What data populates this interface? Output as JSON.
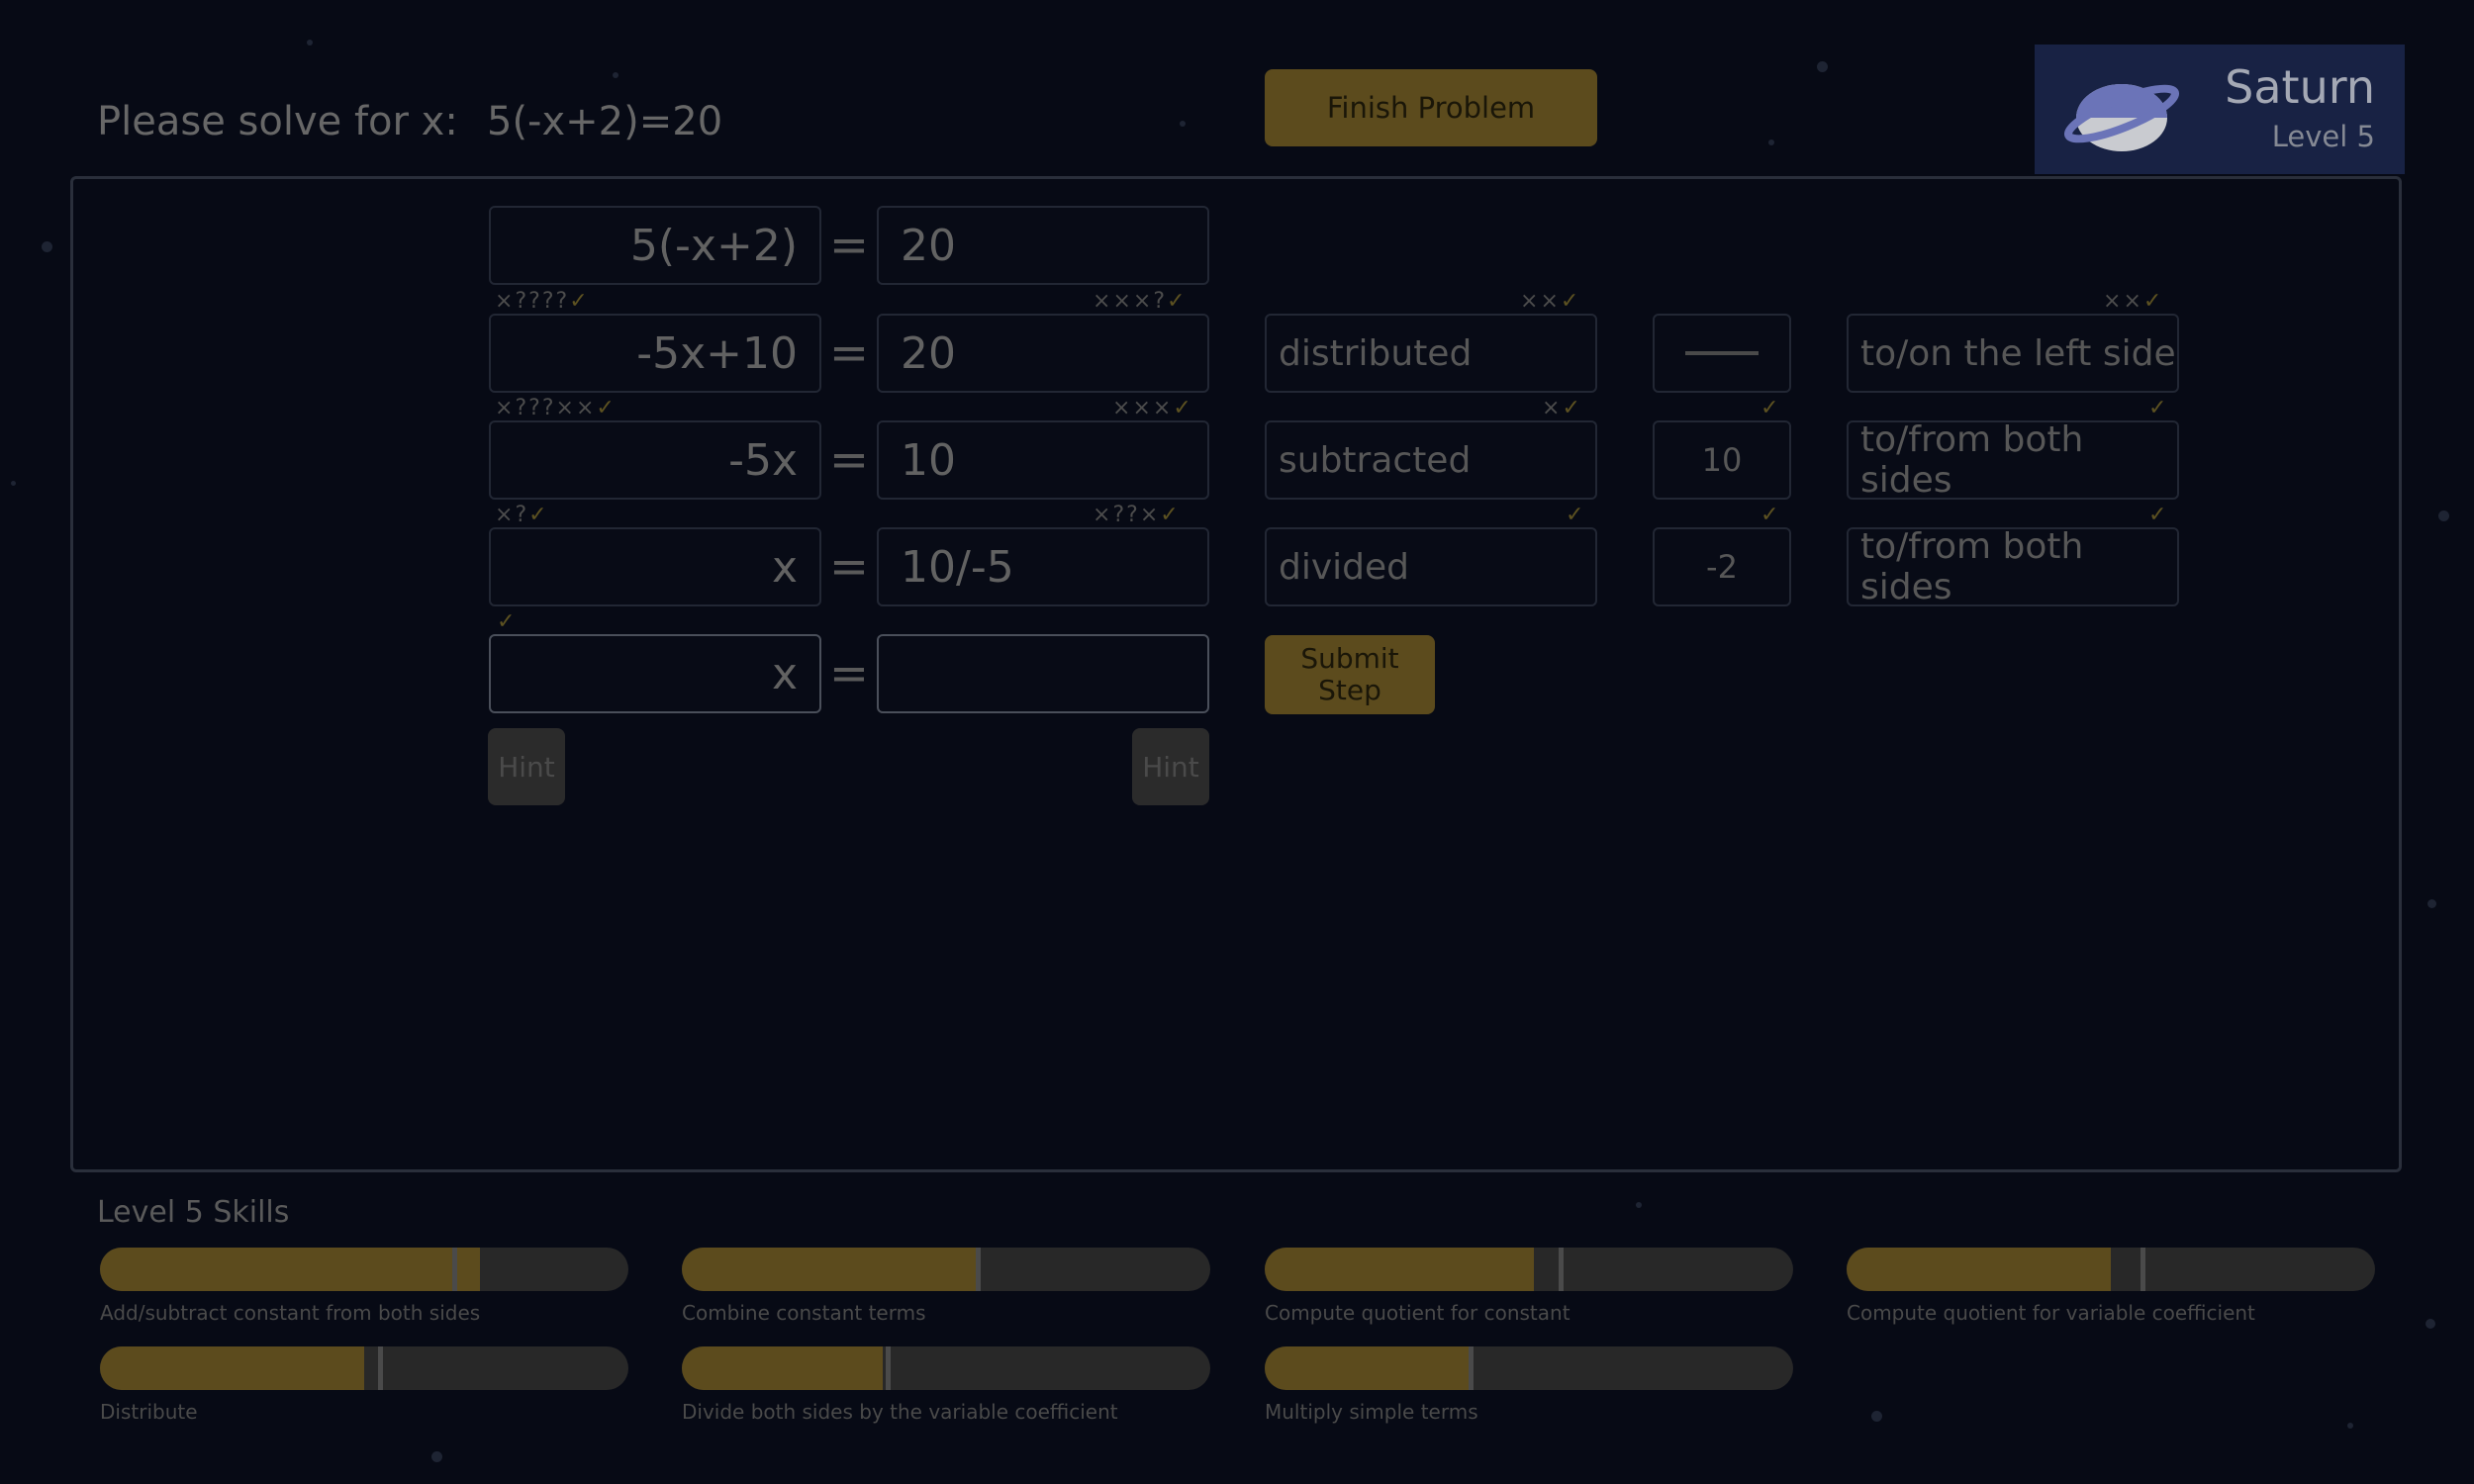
{
  "prompt": {
    "label": "Please solve for x:",
    "equation": "5(-x+2)=20"
  },
  "finish_button": "Finish Problem",
  "planet": {
    "name": "Saturn",
    "level": "Level 5"
  },
  "rows": [
    {
      "left": "5(-x+2)",
      "right": "20",
      "equals": "="
    },
    {
      "left": "-5x+10",
      "right": "20",
      "equals": "=",
      "action": "distributed",
      "value": "",
      "where": "to/on the left side",
      "marks_left": [
        "×",
        "?",
        "?",
        "?",
        "?",
        "✓"
      ],
      "marks_right": [
        "×",
        "×",
        "×",
        "?",
        "✓"
      ],
      "marks_action": [
        "×",
        "×",
        "✓"
      ],
      "marks_where": [
        "×",
        "×",
        "✓"
      ]
    },
    {
      "left": "-5x",
      "right": "10",
      "equals": "=",
      "action": "subtracted",
      "value": "10",
      "where": "to/from both sides",
      "marks_left": [
        "×",
        "?",
        "?",
        "?",
        "×",
        "×",
        "✓"
      ],
      "marks_right": [
        "×",
        "×",
        "×",
        "✓"
      ],
      "marks_action": [
        "×",
        "✓"
      ],
      "marks_value": [
        "✓"
      ],
      "marks_where": [
        "✓"
      ]
    },
    {
      "left": "x",
      "right": "10/-5",
      "equals": "=",
      "action": "divided",
      "value": "-2",
      "where": "to/from both sides",
      "marks_left": [
        "×",
        "?",
        "✓"
      ],
      "marks_right": [
        "×",
        "?",
        "?",
        "×",
        "✓"
      ],
      "marks_action": [
        "✓"
      ],
      "marks_value": [
        "✓"
      ],
      "marks_where": [
        "✓"
      ]
    },
    {
      "left": "x",
      "right": "",
      "equals": "=",
      "marks_left": [
        "✓"
      ]
    }
  ],
  "submit_button": "Submit Step",
  "hint_left": "Hint",
  "hint_right": "Hint",
  "skills_title": "Level 5  Skills",
  "skills": [
    {
      "label": "Add/subtract constant from both sides",
      "fill": 0.72,
      "marker": 0.67
    },
    {
      "label": "Combine constant terms",
      "fill": 0.56,
      "marker": 0.56
    },
    {
      "label": "Compute quotient for constant",
      "fill": 0.51,
      "marker": 0.56
    },
    {
      "label": "Compute quotient for variable coefficient",
      "fill": 0.5,
      "marker": 0.56
    },
    {
      "label": "Distribute",
      "fill": 0.5,
      "marker": 0.53
    },
    {
      "label": "Divide both sides by the variable coefficient",
      "fill": 0.38,
      "marker": 0.39
    },
    {
      "label": "Multiply simple terms",
      "fill": 0.39,
      "marker": 0.39
    }
  ],
  "colors": {
    "background": "#070a15",
    "accent": "#5c4b1d",
    "card": "#182244",
    "check": "#5c5121"
  }
}
